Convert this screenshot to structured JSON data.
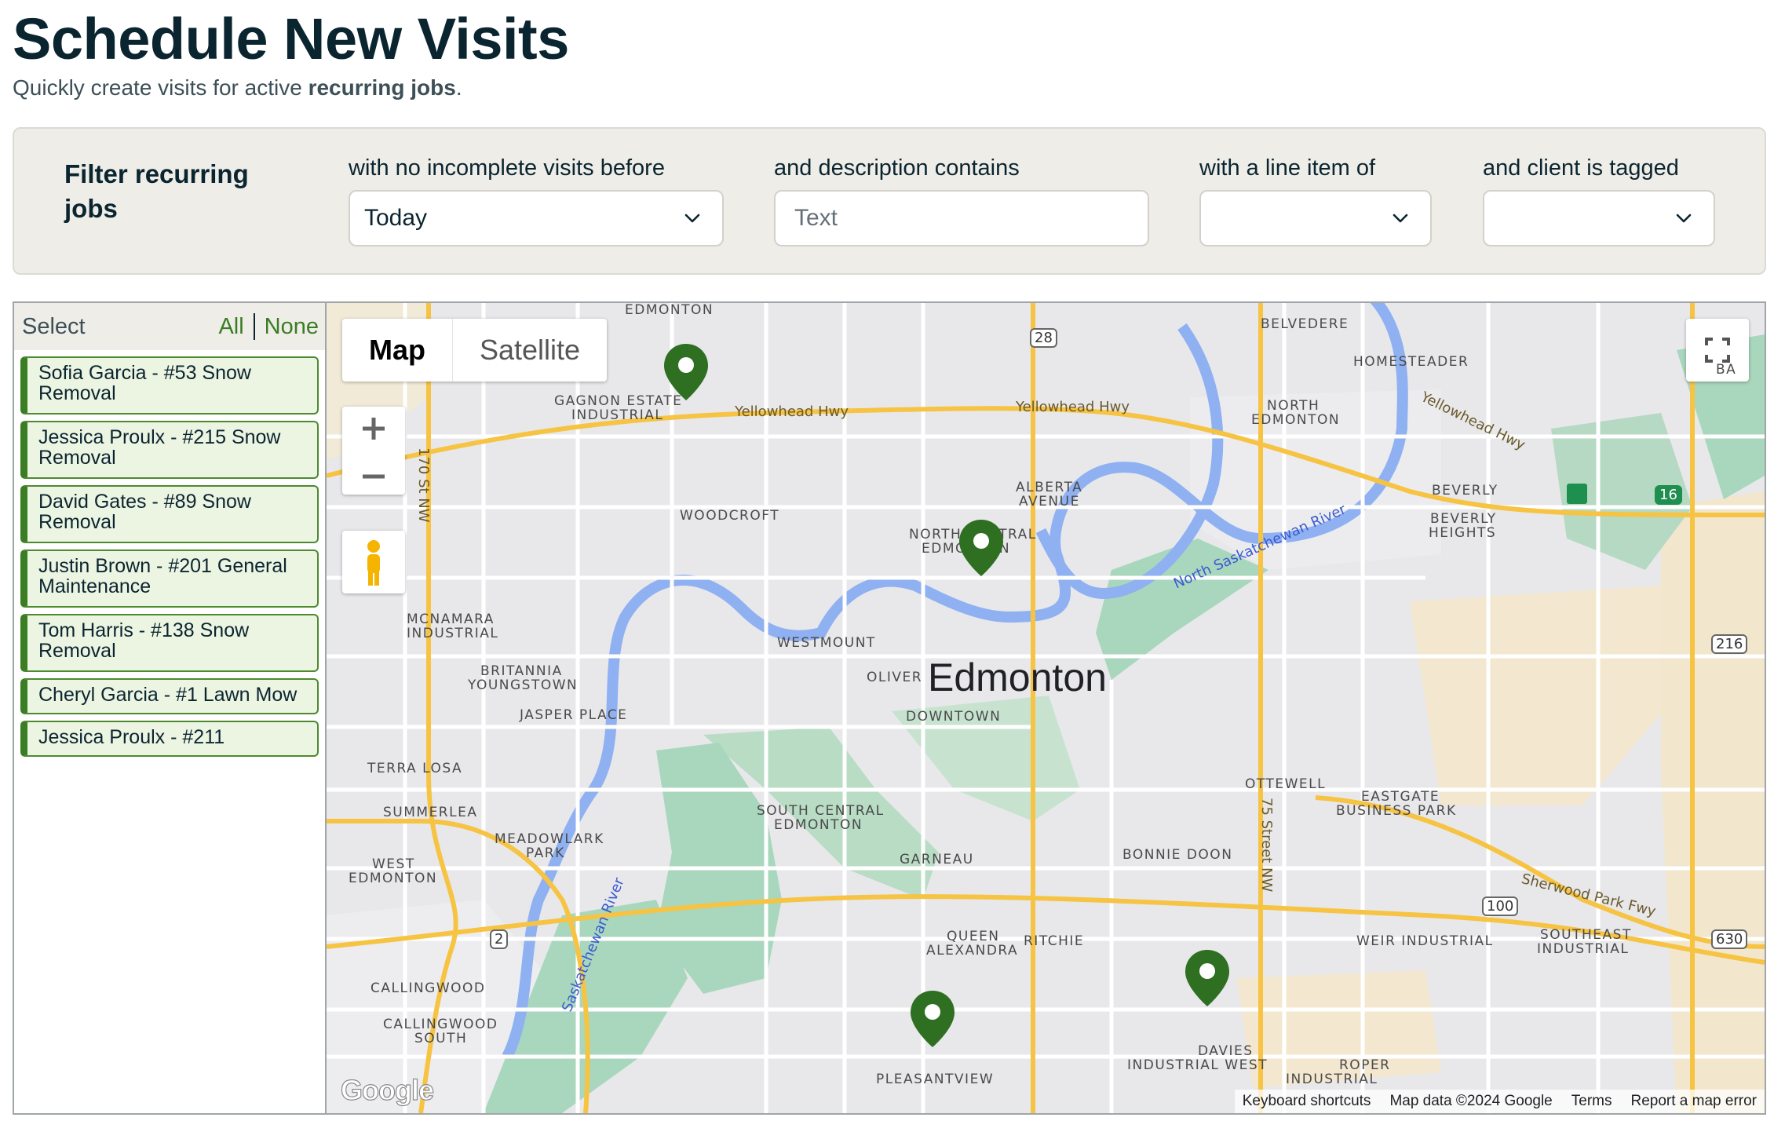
{
  "header": {
    "title": "Schedule New Visits",
    "subtitle_prefix": "Quickly create visits for active ",
    "subtitle_bold": "recurring jobs",
    "subtitle_suffix": "."
  },
  "filters": {
    "title": "Filter recurring jobs",
    "incomplete_label": "with no incomplete visits before",
    "incomplete_value": "Today",
    "description_label": "and description contains",
    "description_placeholder": "Text",
    "line_item_label": "with a line item of",
    "line_item_value": "",
    "tag_label": "and client is tagged",
    "tag_value": ""
  },
  "job_list": {
    "select_label": "Select",
    "all_label": "All",
    "none_label": "None",
    "items": [
      {
        "label": "Sofia Garcia - #53 Snow Removal"
      },
      {
        "label": "Jessica Proulx - #215 Snow Removal"
      },
      {
        "label": "David Gates - #89 Snow Removal"
      },
      {
        "label": "Justin Brown - #201 General Maintenance"
      },
      {
        "label": "Tom Harris - #138 Snow Removal"
      },
      {
        "label": "Cheryl Garcia - #1 Lawn Mow"
      },
      {
        "label": "Jessica Proulx - #211"
      }
    ]
  },
  "map": {
    "type_map": "Map",
    "type_satellite": "Satellite",
    "city": "Edmonton",
    "labels": {
      "edmonton_top": "EDMONTON",
      "belvedere": "BELVEDERE",
      "homesteader": "HOMESTEADER",
      "gagnon": "GAGNON ESTATE",
      "industrial": "INDUSTRIAL",
      "north_edm_1": "NORTH",
      "north_edm_2": "EDMONTON",
      "alberta_1": "ALBERTA",
      "alberta_2": "AVENUE",
      "woodcroft": "WOODCROFT",
      "beverly": "BEVERLY",
      "beverly_h1": "BEVERLY",
      "beverly_h2": "HEIGHTS",
      "nce_1": "NORTH CENTRAL",
      "nce_2": "EDMONTON",
      "mcnamara_1": "MCNAMARA",
      "mcnamara_2": "INDUSTRIAL",
      "westmount": "WESTMOUNT",
      "britannia_1": "BRITANNIA",
      "britannia_2": "YOUNGSTOWN",
      "oliver": "OLIVER",
      "jasper": "JASPER PLACE",
      "downtown": "DOWNTOWN",
      "terra": "TERRA LOSA",
      "ottewell": "OTTEWELL",
      "eastgate_1": "EASTGATE",
      "eastgate_2": "BUSINESS PARK",
      "summerlea": "SUMMERLEA",
      "sce_1": "SOUTH CENTRAL",
      "sce_2": "EDMONTON",
      "meadowlark_1": "MEADOWLARK",
      "meadowlark_2": "PARK",
      "west_edm_1": "WEST",
      "west_edm_2": "EDMONTON",
      "garneau": "GARNEAU",
      "bonnie": "BONNIE DOON",
      "queen_1": "QUEEN",
      "queen_2": "ALEXANDRA",
      "ritchie": "RITCHIE",
      "weir": "WEIR INDUSTRIAL",
      "se_ind_1": "SOUTHEAST",
      "se_ind_2": "INDUSTRIAL",
      "callingwood": "CALLINGWOOD",
      "cw_south_1": "CALLINGWOOD",
      "cw_south_2": "SOUTH",
      "davies_1": "DAVIES",
      "davies_2": "INDUSTRIAL WEST",
      "roper_1": "ROPER",
      "roper_2": "INDUSTRIAL",
      "pleasantview": "PLEASANTVIEW",
      "ba": "BA"
    },
    "roads": {
      "yellowhead_1": "Yellowhead Hwy",
      "yellowhead_2": "Yellowhead Hwy",
      "yellowhead_3": "Yellowhead Hwy",
      "st170": "170 St NW",
      "st75": "75 Street NW",
      "sherwood": "Sherwood Park Fwy",
      "river_north": "North Saskatchewan River",
      "river_south": "Saskatchewan River"
    },
    "shields": {
      "r28": "28",
      "r216": "216",
      "r100": "100",
      "r630": "630",
      "r2": "2",
      "r16": "16"
    },
    "footer": {
      "shortcuts": "Keyboard shortcuts",
      "mapdata": "Map data ©2024 Google",
      "terms": "Terms",
      "report": "Report a map error"
    },
    "logo": "Google"
  }
}
